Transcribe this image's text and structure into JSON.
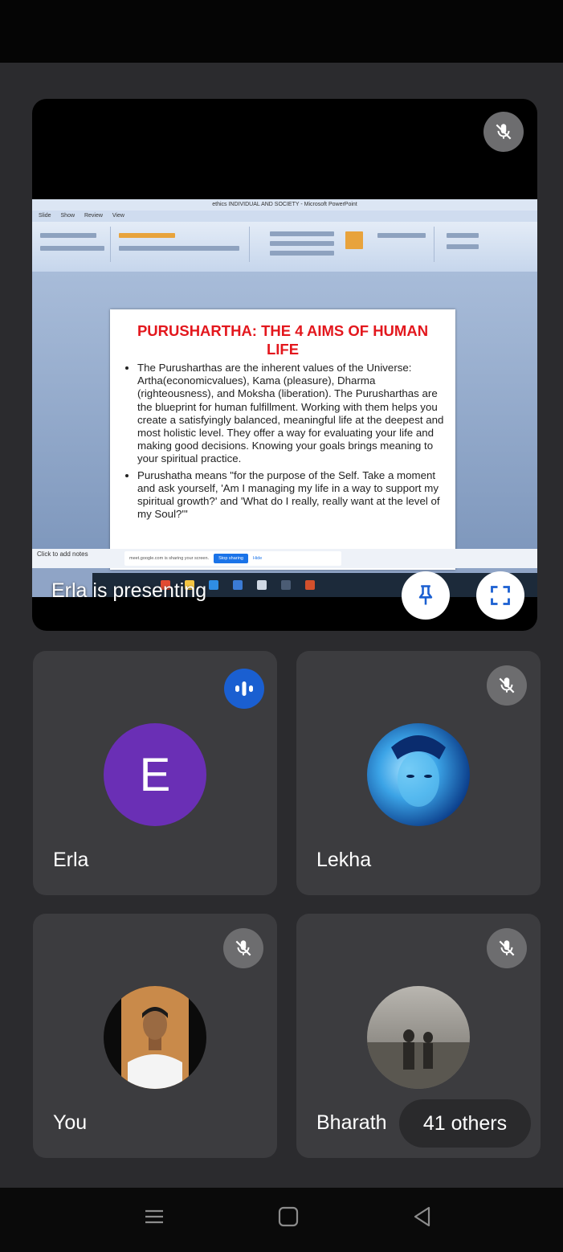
{
  "presentation": {
    "presenting_label": "Erla is presenting",
    "ppt_window_title": "ethics INDIVIDUAL AND SOCIETY - Microsoft PowerPoint",
    "ppt_menu": "Slide Show Review View",
    "slide_title": "PURUSHARTHA: THE 4 AIMS OF HUMAN LIFE",
    "slide_bullet_1": "The Purusharthas are the inherent values of the Universe: Artha(economicvalues), Kama (pleasure), Dharma (righteousness), and Moksha (liberation). The Purusharthas are the blueprint for human fulfillment. Working with them helps you create a satisfyingly balanced, meaningful life at the deepest and most holistic level. They offer a way for evaluating your life and making good decisions. Knowing your goals brings meaning to your spiritual practice.",
    "slide_bullet_2": "Purushatha means \"for the purpose of the Self. Take a moment and ask yourself, 'Am I managing my life in a way to support my spiritual growth?' and 'What do I really, really want at the level of my Soul?'\"",
    "notes_label": "Click to add notes",
    "share_banner_text": "meet.google.com is sharing your screen.",
    "stop_sharing_label": "Stop sharing",
    "hide_label": "Hide"
  },
  "participants": [
    {
      "name": "Erla",
      "avatar_letter": "E",
      "status": "speaking"
    },
    {
      "name": "Lekha",
      "status": "muted"
    },
    {
      "name": "You",
      "status": "muted"
    },
    {
      "name": "Bharath",
      "status": "muted"
    }
  ],
  "others_label": "41 others",
  "colors": {
    "avatar_purple": "#6a2fb5",
    "speaking_blue": "#1a5fd1",
    "slide_title_red": "#e3171d"
  },
  "icons": [
    "mic-off-icon",
    "pin-icon",
    "fullscreen-icon",
    "audio-wave-icon",
    "menu-icon",
    "home-icon",
    "back-icon"
  ]
}
